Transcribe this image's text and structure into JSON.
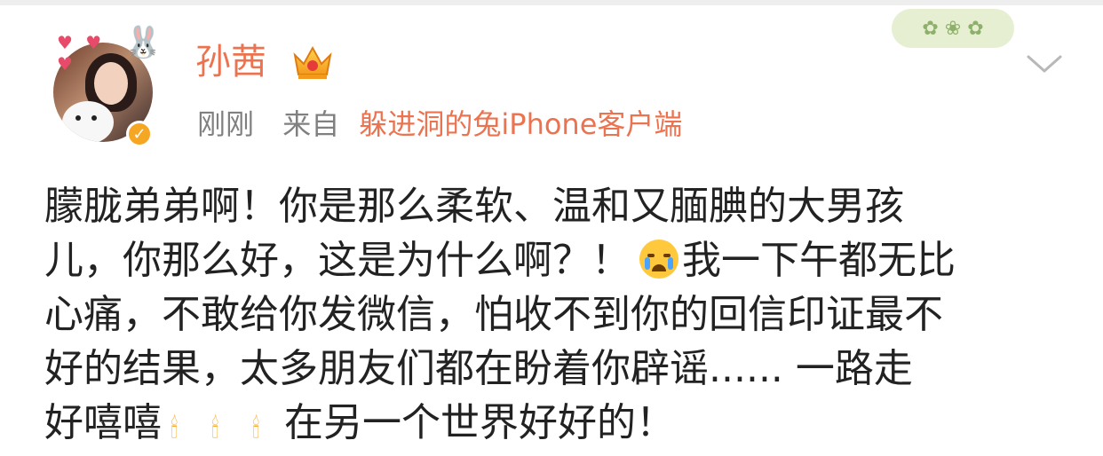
{
  "post": {
    "username": "孙茜",
    "time": "刚刚",
    "from_label": "来自",
    "source": "躲进洞的兔iPhone客户端",
    "icons": {
      "verified": "verified-badge-icon",
      "crown": "crown-icon",
      "more": "chevron-down-icon",
      "emoji": "crying-face-icon",
      "candle": "candle-icon"
    },
    "lines": [
      "朦胧弟弟啊！你是那么柔软、温和又腼腆的大男孩",
      "儿，你那么好，这是为什么啊？！",
      "我一下午都无比",
      "心痛，不敢给你发微信，怕收不到你的回信印证最不",
      "好的结果，太多朋友们都在盼着你辟谣...... 一路走",
      "好嘻嘻",
      "在另一个世界好好的！"
    ]
  },
  "colors": {
    "username": "#eb7350",
    "source": "#eb7350",
    "meta": "#808080",
    "body_text": "#222222"
  }
}
